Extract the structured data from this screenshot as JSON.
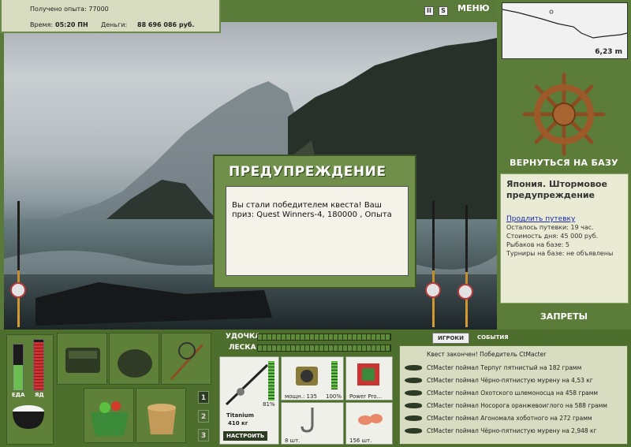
{
  "info": {
    "exp_label": "Получено опыта: 77000",
    "time_label": "Время:",
    "time_value": "05:20 ПН",
    "money_label": "Деньги:",
    "money_value": "88 696 086 руб."
  },
  "top_icons": {
    "pause": "II",
    "sound": "S",
    "menu": "МЕНЮ"
  },
  "minimap": {
    "depth": "6,23 m"
  },
  "right": {
    "back_label": "ВЕРНУТЬСЯ НА БАЗУ",
    "location_title": "Япония. Штормовое предупреждение",
    "extend_link": "Продлить путевку",
    "stats": [
      "Осталось путевки: 19 час.",
      "Стоимость дня: 45 000 руб.",
      "Рыбаков на базе: 5",
      "Турниры на базе: не объявлены"
    ],
    "bans_label": "ЗАПРЕТЫ"
  },
  "dialog": {
    "title": "ПРЕДУПРЕЖДЕНИЕ",
    "message": "Вы стали победителем квеста! Ваш приз: Quest Winners-4, 180000 , Опыта"
  },
  "status": {
    "food_label": "ЕДА",
    "energy_label": "ЯД",
    "food_level": 0.55,
    "energy_level": 0.95
  },
  "tackle": {
    "rod_label": "УДОЧКА",
    "line_label": "ЛЕСКА",
    "rod_name": "Titanium",
    "rod_weight": "410 кг",
    "rod_percent": "81%",
    "reel_caption": "мощн.: 135",
    "reel_percent": "100%",
    "line_caption": "Power Pro...",
    "hook_count": "8 шт.",
    "bait_count": "156 шт.",
    "tune_button": "НАСТРОИТЬ"
  },
  "slot_numbers": [
    "1",
    "2",
    "3"
  ],
  "log": {
    "tab_players": "ИГРОКИ",
    "tab_events": "СОБЫТИЯ",
    "header": "Квест закончен! Победитель CtMacter",
    "rows": [
      "CtMacter поймал Терпуг пятнистый на 182 грамм",
      "CtMacter поймал Чёрно-пятнистую мурену на 4,53 кг",
      "CtMacter поймал Охотского шлемоносца на 458 грамм",
      "CtMacter поймал Носорога оранжевоиглого на 588 грамм",
      "CtMacter поймал Агономала хоботного на 272 грамм",
      "CtMacter поймал Чёрно-пятнистую мурену на 2,948 кг"
    ]
  }
}
